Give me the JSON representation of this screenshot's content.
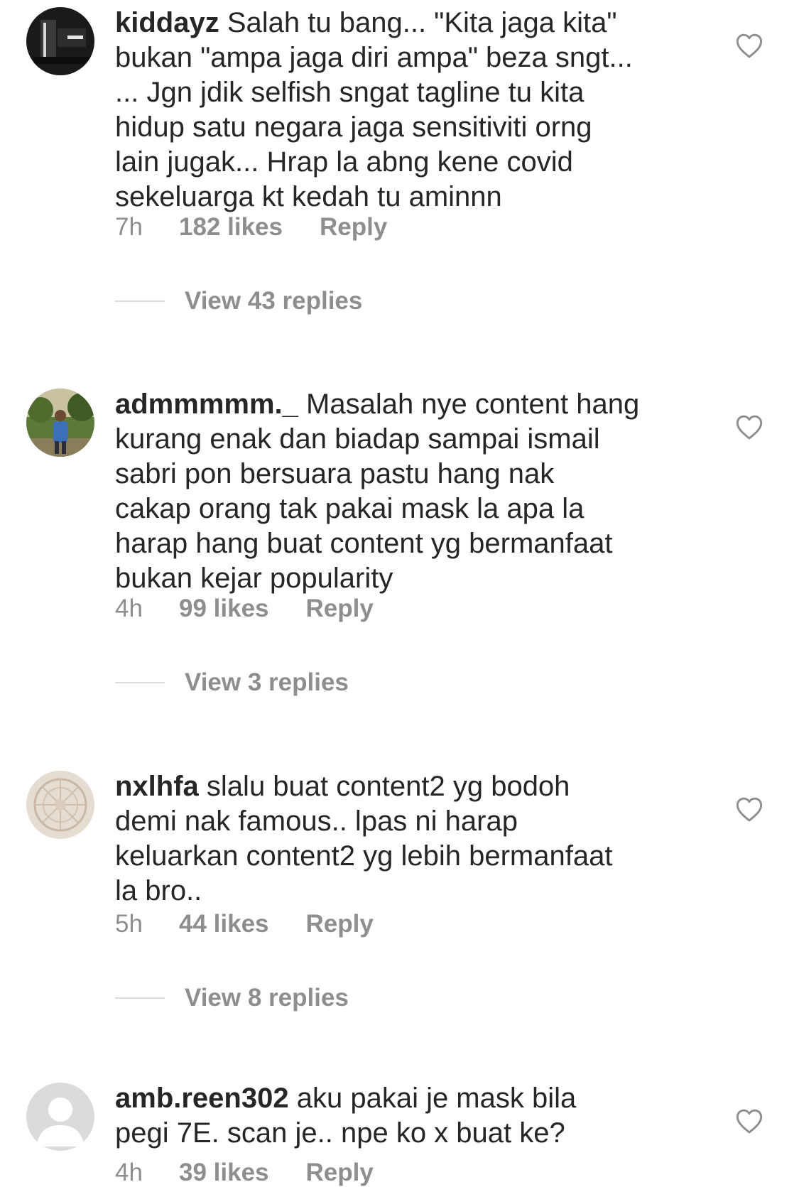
{
  "comments": [
    {
      "username": "kiddayz",
      "text": "Salah tu bang... \"Kita jaga kita\"\nbukan \"ampa jaga diri ampa\" beza sngt...\n... Jgn jdik selfish sngat tagline tu kita\nhidup satu negara jaga sensitiviti orng\nlain jugak... Hrap la abng kene covid\nsekeluarga kt kedah tu aminnn",
      "time": "7h",
      "likes": "182 likes",
      "reply": "Reply",
      "view_replies": "View 43 replies",
      "avatar_icon": "mcdonalds-photo-avatar"
    },
    {
      "username": "admmmmm._",
      "text": "Masalah nye content hang\nkurang enak dan biadap sampai ismail\nsabri pon  bersuara pastu hang nak\ncakap orang tak pakai mask la apa la\nharap hang buat content yg bermanfaat\nbukan kejar popularity",
      "time": "4h",
      "likes": "99 likes",
      "reply": "Reply",
      "view_replies": "View 3 replies",
      "avatar_icon": "person-outdoor-avatar"
    },
    {
      "username": "nxlhfa",
      "text": "slalu buat content2 yg bodoh\ndemi nak famous.. lpas ni harap\nkeluarkan content2 yg lebih bermanfaat\nla bro..",
      "time": "5h",
      "likes": "44 likes",
      "reply": "Reply",
      "view_replies": "View 8 replies",
      "avatar_icon": "pattern-avatar"
    },
    {
      "username": "amb.reen302",
      "text": "aku pakai je mask bila\npegi 7E. scan je.. npe ko x buat ke?",
      "time": "4h",
      "likes": "39 likes",
      "reply": "Reply",
      "avatar_icon": "default-user-avatar"
    }
  ],
  "colors": {
    "text": "#262626",
    "muted": "#8e8e8e",
    "divider": "#dbdbdb"
  }
}
